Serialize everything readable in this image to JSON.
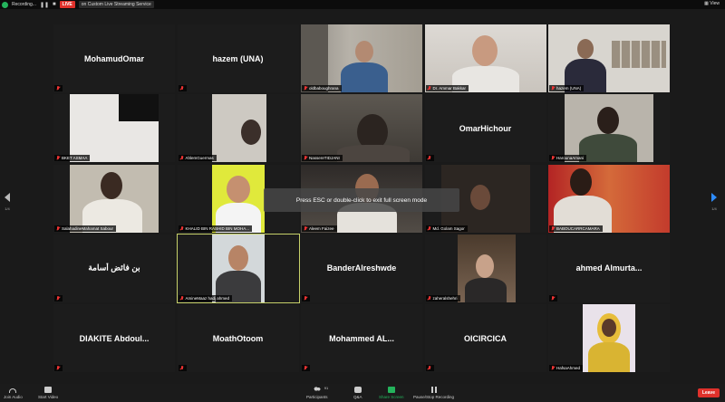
{
  "topbar": {
    "recording_label": "Recording...",
    "live_label": "LIVE",
    "stream_label": "on Custom Live Streaming Service",
    "view_label": "View"
  },
  "tiles": [
    {
      "name": "MohamudOmar",
      "video": false
    },
    {
      "name": "hazem (UNA)",
      "video": false
    },
    {
      "name": "oldbaboughrana",
      "video": true
    },
    {
      "name": "Dr. Ammar Bakkar",
      "video": true
    },
    {
      "name": "hazem (UNA)",
      "video": true
    },
    {
      "name": "BKET ASMAA",
      "video": true
    },
    {
      "name": "AhlemGuermas",
      "video": true
    },
    {
      "name": "NassereTIDJANI",
      "video": true
    },
    {
      "name": "OmarHichour",
      "video": false
    },
    {
      "name": "HarounaAmani",
      "video": true
    },
    {
      "name": "SalahadineMahamat Sabour",
      "video": true
    },
    {
      "name": "KHALID BIN RASHID BIN MOHA...",
      "video": true
    },
    {
      "name": "Aleem Faizee",
      "video": true
    },
    {
      "name": "Md. Golam Sagor",
      "video": true
    },
    {
      "name": "BABOUCARRCAMARA",
      "video": true
    },
    {
      "name": "بن فائض أسامة",
      "video": false
    },
    {
      "name": "AmineMaaz hadj ahmed",
      "video": true
    },
    {
      "name": "BanderAlreshwde",
      "video": false
    },
    {
      "name": "zaheralshehri",
      "video": true
    },
    {
      "name": "ahmed  Almurta...",
      "video": false
    },
    {
      "name": "DIAKITE  Abdoul...",
      "video": false
    },
    {
      "name": "MoathOtoom",
      "video": false
    },
    {
      "name": "Mohammed  AL...",
      "video": false
    },
    {
      "name": "OICIRCICA",
      "video": false
    },
    {
      "name": "HafsaAhmed",
      "video": true
    }
  ],
  "toast": "Press ESC or double-click to exit full screen mode",
  "pager": {
    "left": "1/4",
    "right": "1/4"
  },
  "toolbar": {
    "join_audio": "Join Audio",
    "start_video": "Start Video",
    "participants": "Participants",
    "participants_count": "91",
    "qa": "Q&A",
    "share_screen": "Share Screen",
    "pause_stop": "Pause/Stop Recording",
    "leave": "Leave"
  }
}
